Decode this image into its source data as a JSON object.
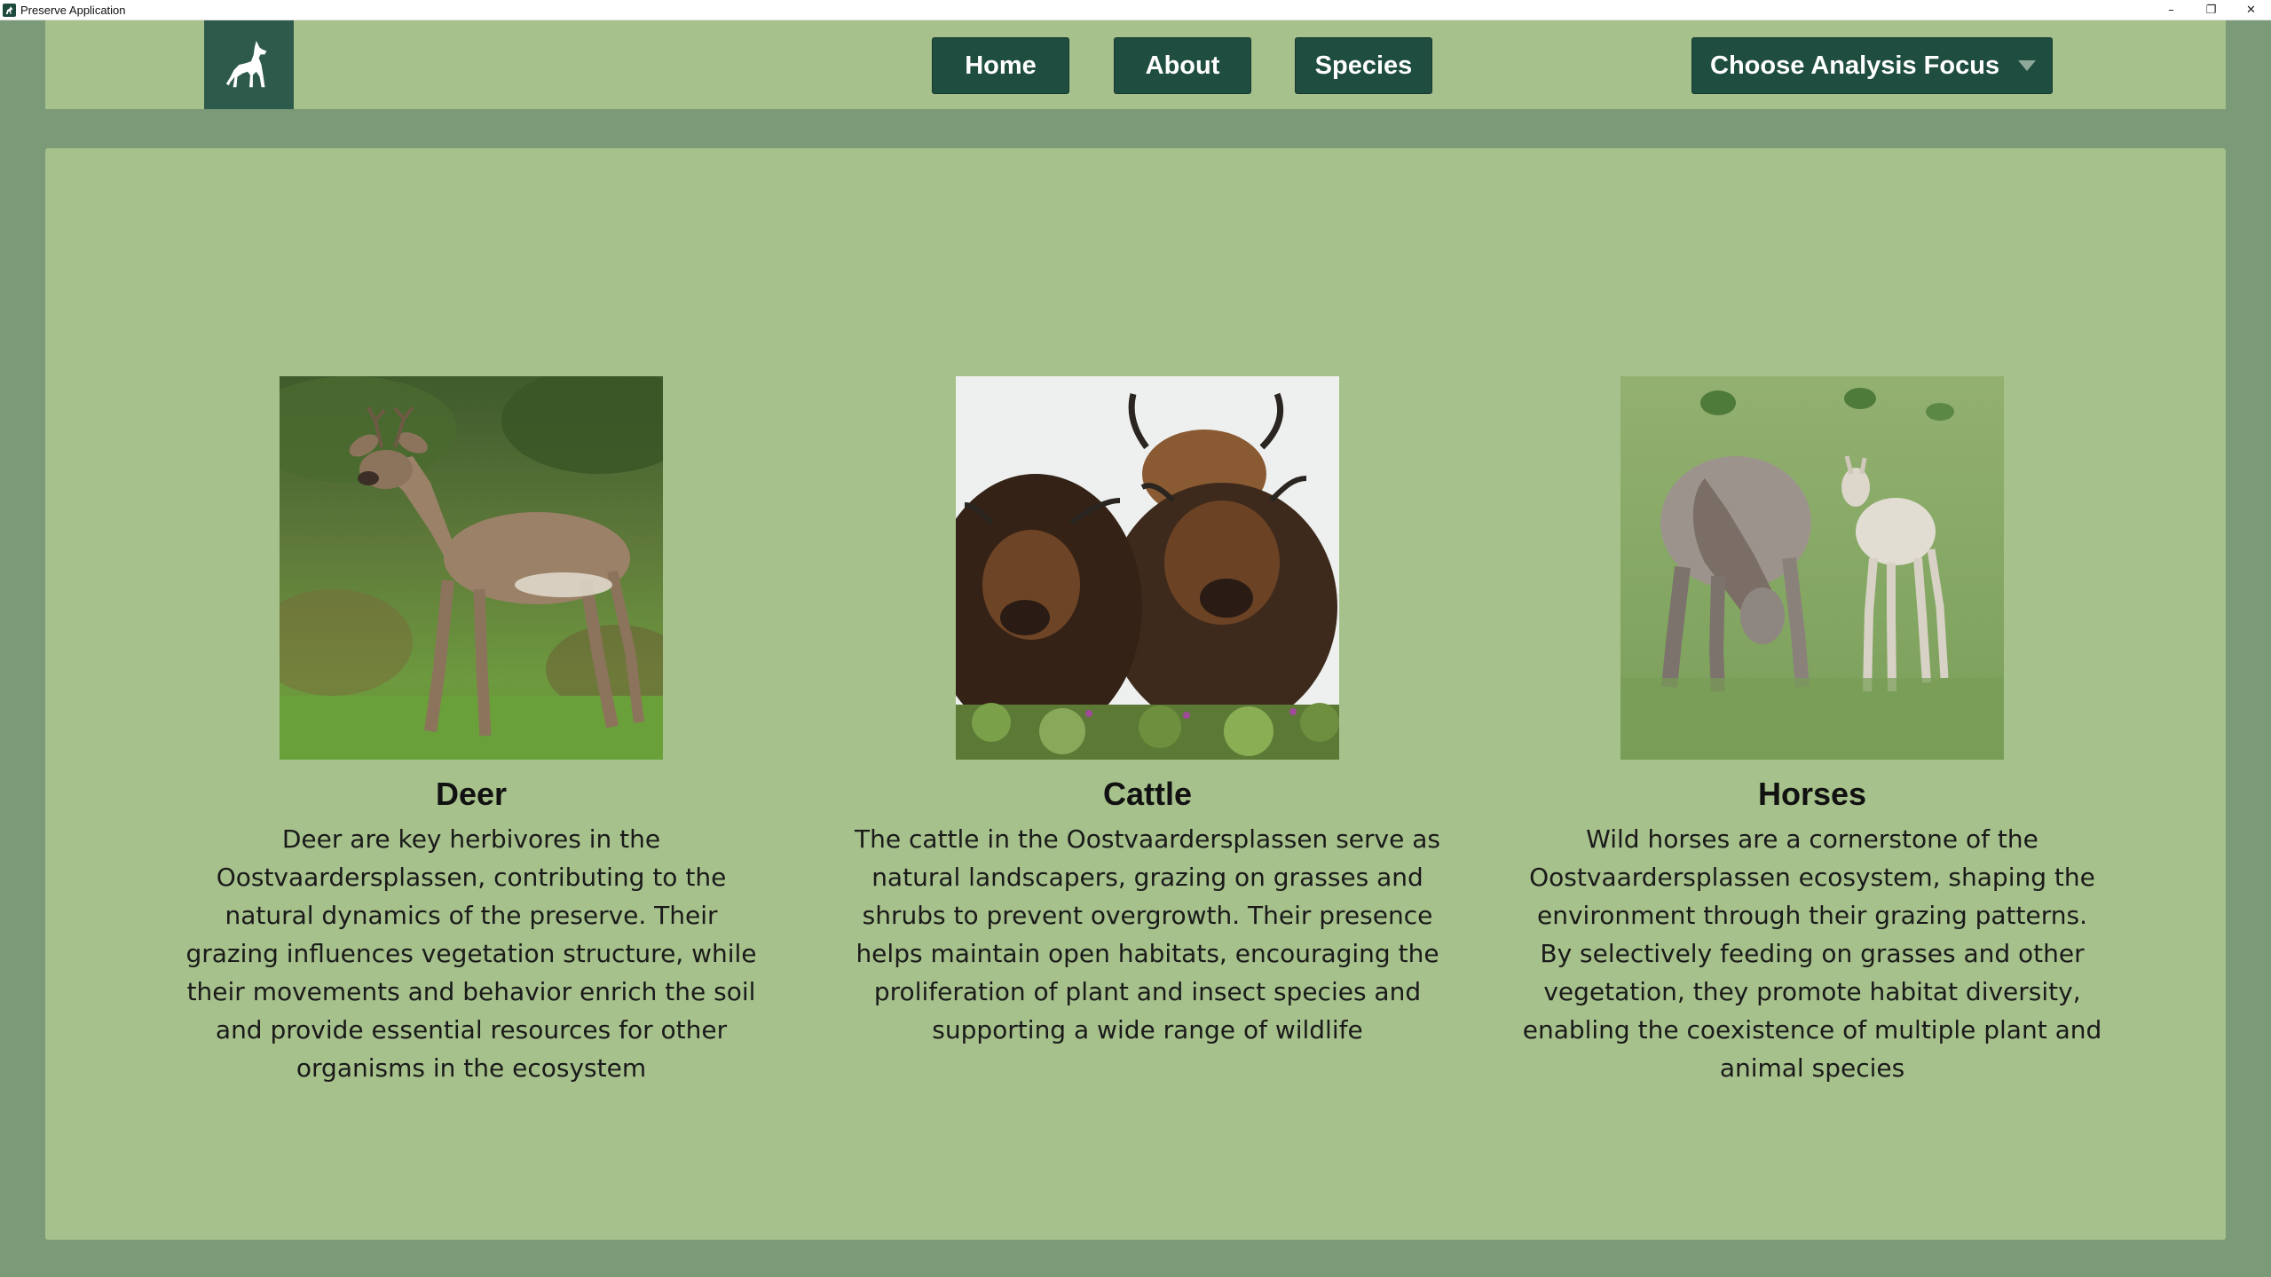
{
  "window": {
    "title": "Preserve Application",
    "controls": {
      "minimize": "–",
      "restore": "❐",
      "close": "✕"
    }
  },
  "nav": {
    "logo": "wolf-logo",
    "home_label": "Home",
    "about_label": "About",
    "species_label": "Species",
    "focus_select_label": "Choose Analysis Focus"
  },
  "colors": {
    "app_background": "#7a9a78",
    "panel": "#a6c18b",
    "button": "#1f4d3f",
    "logo_box": "#2d5a4a"
  },
  "species": [
    {
      "name": "Deer",
      "image": "deer-photo",
      "description": "Deer are key herbivores in the Oostvaardersplassen, contributing to the natural dynamics of the preserve. Their grazing influences vegetation structure, while their movements and behavior enrich the soil and provide essential resources for other organisms in the ecosystem"
    },
    {
      "name": "Cattle",
      "image": "cattle-photo",
      "description": "The cattle in the Oostvaardersplassen serve as natural landscapers, grazing on grasses and shrubs to prevent overgrowth. Their presence helps maintain open habitats, encouraging the proliferation of plant and insect species and supporting a wide range of wildlife"
    },
    {
      "name": "Horses",
      "image": "horses-photo",
      "description": "Wild horses are a cornerstone of the Oostvaardersplassen ecosystem, shaping the environment through their grazing patterns. By selectively feeding on grasses and other vegetation, they promote habitat diversity, enabling the coexistence of multiple plant and animal species"
    }
  ]
}
